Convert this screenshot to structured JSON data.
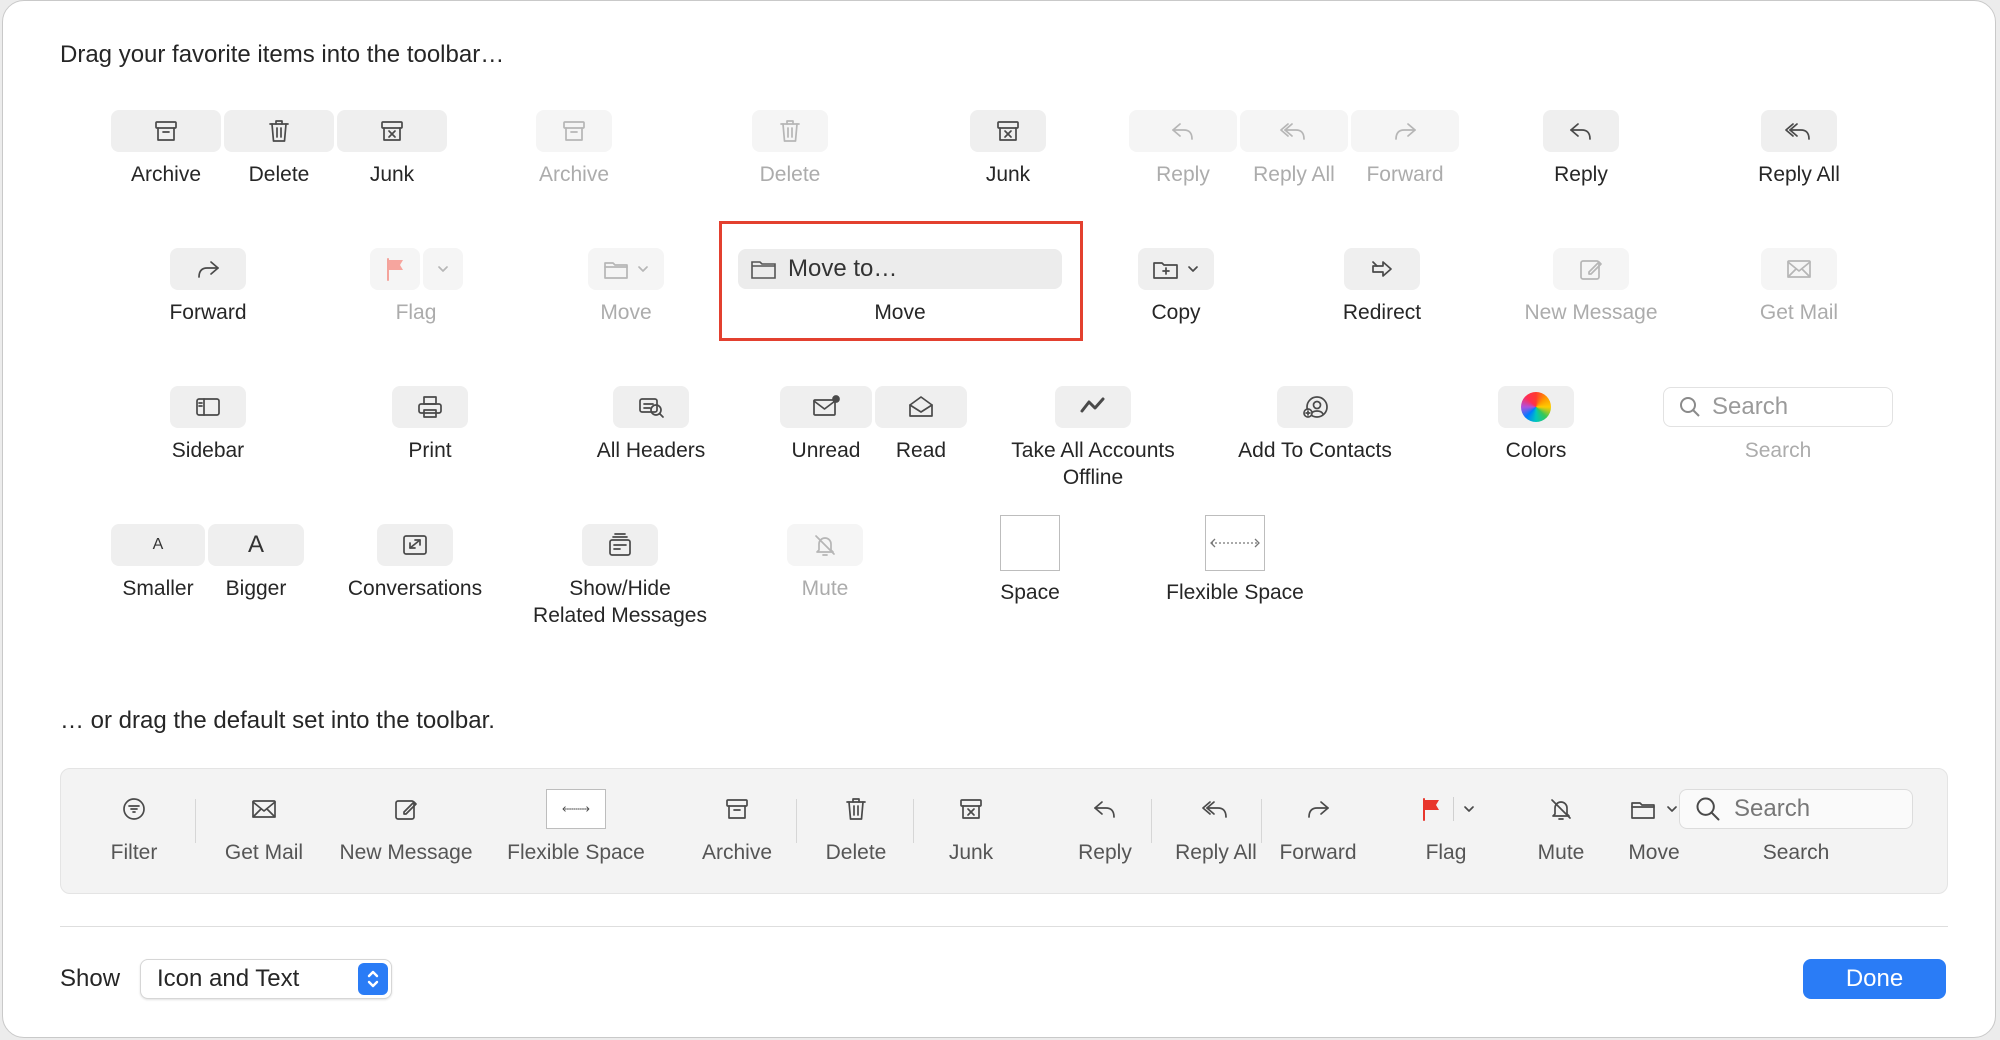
{
  "instructions": {
    "favorites": "Drag your favorite items into the toolbar…",
    "defaults": "… or drag the default set into the toolbar."
  },
  "palette": {
    "archive_delete_junk": [
      "Archive",
      "Delete",
      "Junk"
    ],
    "archive": "Archive",
    "delete": "Delete",
    "junk": "Junk",
    "reply_replyall_forward": [
      "Reply",
      "Reply All",
      "Forward"
    ],
    "reply": "Reply",
    "reply_all": "Reply All",
    "forward": "Forward",
    "flag": "Flag",
    "move": "Move",
    "move_to": {
      "field": "Move to…",
      "label": "Move"
    },
    "copy": "Copy",
    "redirect": "Redirect",
    "new_message": "New Message",
    "get_mail": "Get Mail",
    "sidebar": "Sidebar",
    "print": "Print",
    "all_headers": "All Headers",
    "unread_read": [
      "Unread",
      "Read"
    ],
    "take_offline": [
      "Take All Accounts",
      "Offline"
    ],
    "add_to_contacts": "Add To Contacts",
    "colors": "Colors",
    "search": {
      "placeholder": "Search",
      "label": "Search"
    },
    "smaller_bigger": [
      "Smaller",
      "Bigger"
    ],
    "smaller_glyph": "A",
    "bigger_glyph": "A",
    "conversations": "Conversations",
    "show_hide": [
      "Show/Hide",
      "Related Messages"
    ],
    "mute": "Mute",
    "space": "Space",
    "flexible_space": "Flexible Space"
  },
  "default_set": {
    "items": [
      "Filter",
      "Get Mail",
      "New Message",
      "Flexible Space",
      "Archive",
      "Delete",
      "Junk",
      "Reply",
      "Reply All",
      "Forward",
      "Flag",
      "Mute",
      "Move"
    ],
    "search_placeholder": "Search",
    "search_label": "Search"
  },
  "footer": {
    "show_label": "Show",
    "show_value": "Icon and Text",
    "done_label": "Done"
  },
  "colors": {
    "accent": "#2a7cf6",
    "highlight_box": "#e3402f",
    "flag_red": "#e8362c"
  }
}
